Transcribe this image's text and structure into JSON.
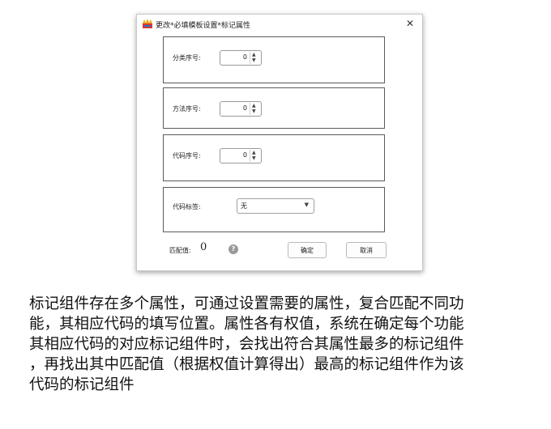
{
  "dialog": {
    "title": "更改*必填模板设置*标记属性",
    "close_glyph": "✕",
    "fields": [
      {
        "label": "分类序号:",
        "value": "0"
      },
      {
        "label": "方法序号:",
        "value": "0"
      },
      {
        "label": "代码序号:",
        "value": "0"
      }
    ],
    "tag_field": {
      "label": "代码标签:",
      "value": "无"
    },
    "match": {
      "label": "匹配值:",
      "value": "0"
    },
    "help_glyph": "?",
    "ok_label": "确定",
    "cancel_label": "取消"
  },
  "description": {
    "lines": [
      "标记组件存在多个属性，可通过设置需要的属性，复合匹配不同功",
      "能，其相应代码的填写位置。属性各有权值，系统在确定每个功能",
      "其相应代码的对应标记组件时，会找出符合其属性最多的标记组件",
      "，再找出其中匹配值（根据权值计算得出）最高的标记组件作为该",
      "代码的标记组件"
    ]
  }
}
